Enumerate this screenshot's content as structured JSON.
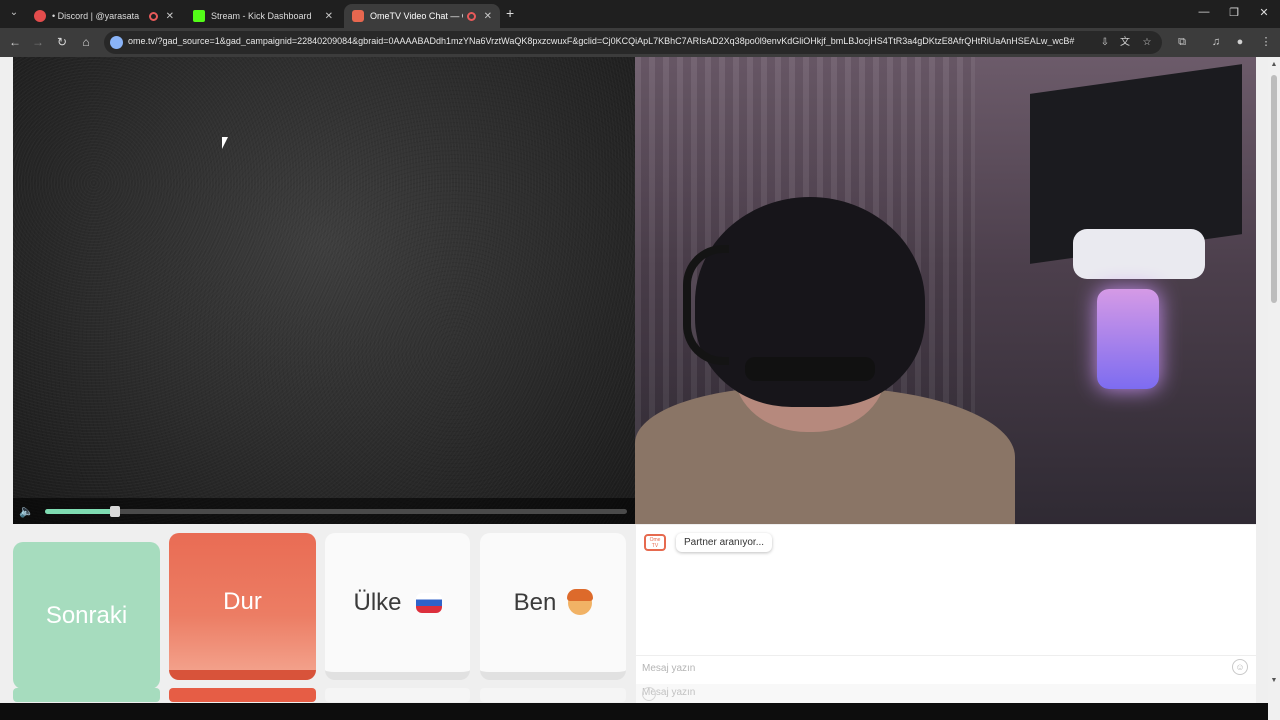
{
  "browser": {
    "tabs": [
      {
        "title": "• Discord | @yarasata",
        "favicon_color": "#e34c4c",
        "recording": true
      },
      {
        "title": "Stream - Kick Dashboard",
        "favicon_color": "#53fc18",
        "recording": false
      },
      {
        "title": "OmeTV Video Chat — Ome",
        "favicon_color": "#e8674f",
        "recording": true,
        "active": true
      }
    ],
    "new_tab_symbol": "+",
    "url": "ome.tv/?gad_source=1&gad_campaignid=22840209084&gbraid=0AAAABADdh1mzYNa6VrztWaQK8pxzcwuxF&gclid=Cj0KCQiApL7KBhC7ARIsAD2Xq38po0l9envKdGliOHkjf_bmLBJocjHS4TtR3a4gDKtzE8AfrQHtRiUaAnHSEALw_wcB#",
    "window_controls": [
      "—",
      "❐",
      "✕"
    ]
  },
  "video": {
    "volume_level": 0.12,
    "partner_state": "searching",
    "self_camera": "on"
  },
  "controls": {
    "next_label": "Sonraki",
    "stop_label": "Dur",
    "country_label": "Ülke",
    "country_flag": "russia-flag",
    "me_label": "Ben",
    "me_icon": "boy-emoji-icon"
  },
  "chat": {
    "logo_text": "Ome TV",
    "status_message": "Partner aranıyor...",
    "input_placeholder": "Mesaj yazın",
    "ghost_placeholder": "Mesaj yazın"
  },
  "colors": {
    "next": "#a6dcbe",
    "stop": "#e96c54",
    "accent_green": "#7fdcb2"
  }
}
